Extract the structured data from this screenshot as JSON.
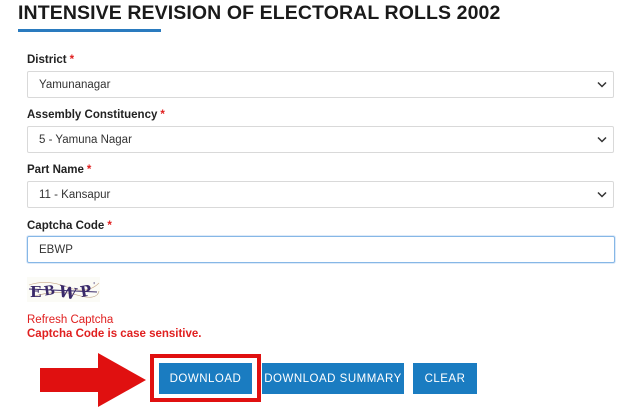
{
  "page": {
    "title": "INTENSIVE REVISION OF ELECTORAL ROLLS 2002"
  },
  "form": {
    "required_mark": "*",
    "district": {
      "label": "District",
      "value": "Yamunanagar"
    },
    "assembly": {
      "label": "Assembly Constituency",
      "value": "5 - Yamuna Nagar"
    },
    "part": {
      "label": "Part Name",
      "value": "11 - Kansapur"
    },
    "captcha": {
      "label": "Captcha Code",
      "value": "EBWP",
      "image_text": "EBWP",
      "refresh_label": "Refresh Captcha",
      "case_note": "Captcha Code is case sensitive."
    }
  },
  "buttons": {
    "download": "DOWNLOAD",
    "download_summary": "DOWNLOAD SUMMARY",
    "clear": "CLEAR"
  },
  "colors": {
    "accent": "#1a7cc1",
    "required": "#e02020",
    "annotation": "#e01010"
  }
}
